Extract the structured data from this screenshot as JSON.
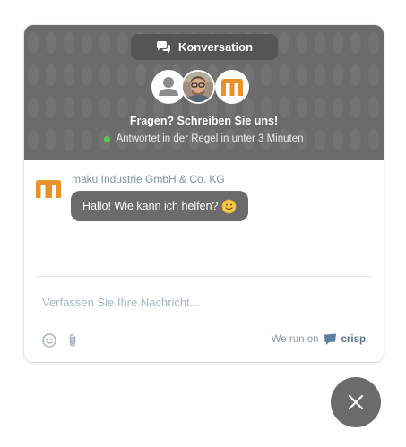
{
  "header": {
    "conversation_label": "Konversation",
    "title": "Fragen? Schreiben Sie uns!",
    "status": "Antwortet in der Regel in unter 3 Minuten"
  },
  "messages": [
    {
      "sender": "maku Industrie GmbH & Co. KG",
      "text": "Hallo! Wie kann ich helfen?"
    }
  ],
  "composer": {
    "placeholder": "Verfassen Sie Ihre Nachricht..."
  },
  "footer": {
    "powered_by": "We run on",
    "brand": "crisp"
  },
  "colors": {
    "header_bg": "#6b6b6b",
    "online_dot": "#55c94e",
    "brand_orange": "#e8922a",
    "bubble_bg": "#6b6b6b"
  }
}
